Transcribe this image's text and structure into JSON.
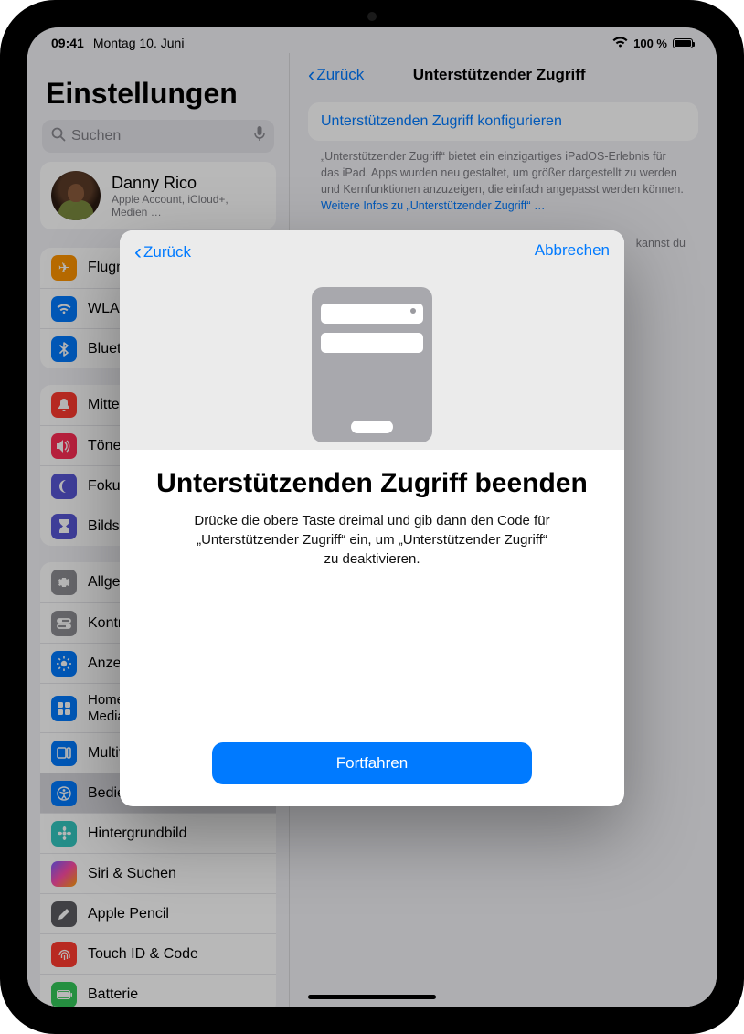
{
  "status": {
    "time": "09:41",
    "date": "Montag 10. Juni",
    "battery_pct": "100 %"
  },
  "sidebar": {
    "title": "Einstellungen",
    "search_placeholder": "Suchen",
    "account": {
      "name": "Danny Rico",
      "sub": "Apple Account, iCloud+, Medien …"
    },
    "g1": {
      "i0": "Flugmodus",
      "i1": "WLAN",
      "i2": "Bluetooth"
    },
    "g2": {
      "i0": "Mitteilungen",
      "i1": "Töne",
      "i2": "Fokus",
      "i3": "Bildschirmzeit"
    },
    "g3": {
      "i0": "Allgemein",
      "i1": "Kontrollzentrum",
      "i2": "Anzeige & Helligkeit",
      "i3": "Home-Bildschirm & App-Mediathek",
      "i4": "Multitasking & Gesten",
      "i5": "Bedienungshilfen",
      "i6": "Hintergrundbild",
      "i7": "Siri & Suchen",
      "i8": "Apple Pencil",
      "i9": "Touch ID & Code",
      "i10": "Batterie"
    }
  },
  "detail": {
    "back": "Zurück",
    "title": "Unterstützender Zugriff",
    "link": "Unterstützenden Zugriff konfigurieren",
    "desc": "„Unterstützender Zugriff“ bietet ein einzigartiges iPadOS-Erlebnis für das iPad. Apps wurden neu gestaltet, um größer dargestellt zu werden und Kernfunktionen anzuzeigen, die einfach angepasst werden können.",
    "more": "Weitere Infos zu „Unterstützender Zugriff“ …",
    "note_tail": "kannst du"
  },
  "modal": {
    "back": "Zurück",
    "cancel": "Abbrechen",
    "title": "Unterstützenden Zugriff beenden",
    "text": "Drücke die obere Taste dreimal und gib dann den Code für „Unterstützender Zugriff“ ein, um „Unterstützender Zugriff“ zu deaktivieren.",
    "continue": "Fortfahren"
  }
}
